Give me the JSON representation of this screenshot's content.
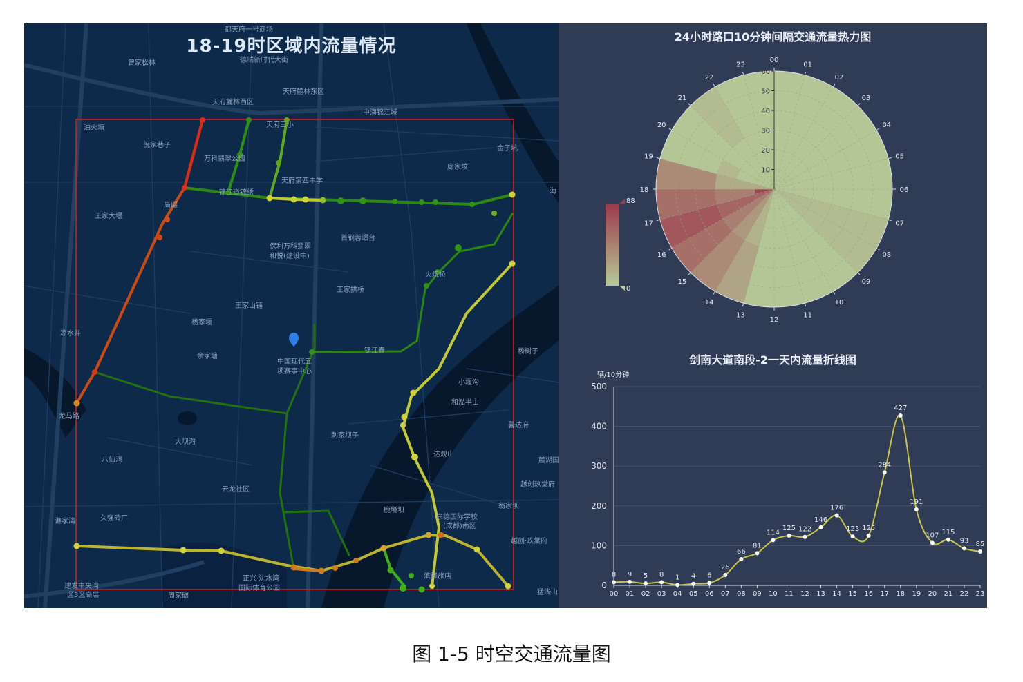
{
  "map": {
    "title": "18-19时区域内流量情况",
    "places": [
      {
        "id": "p1",
        "text": "都天府一号商场"
      },
      {
        "id": "p2",
        "text": "曾家松林"
      },
      {
        "id": "p3",
        "text": "德瑞新时代大街"
      },
      {
        "id": "p4",
        "text": "天府麓林东区"
      },
      {
        "id": "p5",
        "text": "天府麓林西区"
      },
      {
        "id": "p6",
        "text": "中海锦江城"
      },
      {
        "id": "p7",
        "text": "天府三小"
      },
      {
        "id": "p8",
        "text": "油火塘"
      },
      {
        "id": "p9",
        "text": "倪家巷子"
      },
      {
        "id": "p10",
        "text": "万科翡翠公园"
      },
      {
        "id": "p11",
        "text": "金子坑"
      },
      {
        "id": "p12",
        "text": "廊家坟"
      },
      {
        "id": "p13",
        "text": "锦江道锦绣"
      },
      {
        "id": "p14",
        "text": "天府第四中学"
      },
      {
        "id": "p15",
        "text": "高碾"
      },
      {
        "id": "p16",
        "text": "王家大堰"
      },
      {
        "id": "p17",
        "text": "首钢蓉璟台"
      },
      {
        "id": "p18",
        "text": "保利万科翡翠"
      },
      {
        "id": "p19",
        "text": "和悦(建设中)"
      },
      {
        "id": "p20",
        "text": "火烧桥"
      },
      {
        "id": "p21",
        "text": "王家拱桥"
      },
      {
        "id": "p22",
        "text": "王家山铺"
      },
      {
        "id": "p23",
        "text": "杨家堰"
      },
      {
        "id": "p24",
        "text": "凉水井"
      },
      {
        "id": "p25",
        "text": "余家塘"
      },
      {
        "id": "p26",
        "text": "中国现代五"
      },
      {
        "id": "p27",
        "text": "项赛事中心"
      },
      {
        "id": "p28",
        "text": "锦江春"
      },
      {
        "id": "p29",
        "text": "杨树子"
      },
      {
        "id": "p30",
        "text": "小堰沟"
      },
      {
        "id": "p31",
        "text": "和泓半山"
      },
      {
        "id": "p32",
        "text": "龙马路"
      },
      {
        "id": "p33",
        "text": "刺家坝子"
      },
      {
        "id": "p34",
        "text": "大坝沟"
      },
      {
        "id": "p35",
        "text": "馨达府"
      },
      {
        "id": "p36",
        "text": "达观山"
      },
      {
        "id": "p37",
        "text": "八仙洞"
      },
      {
        "id": "p38",
        "text": "麓湖国"
      },
      {
        "id": "p39",
        "text": "越创玖棠府"
      },
      {
        "id": "p40",
        "text": "云龙社区"
      },
      {
        "id": "p41",
        "text": "康德国际学校"
      },
      {
        "id": "p42",
        "text": "(成都)南区"
      },
      {
        "id": "p43",
        "text": "谯家湾"
      },
      {
        "id": "p44",
        "text": "久强砖厂"
      },
      {
        "id": "p45",
        "text": "鹿境坝"
      },
      {
        "id": "p46",
        "text": "翁家坝"
      },
      {
        "id": "p47",
        "text": "越创·玖棠府"
      },
      {
        "id": "p48",
        "text": "正兴·沈水湾"
      },
      {
        "id": "p49",
        "text": "国际体育公园"
      },
      {
        "id": "p50",
        "text": "建发中央湾"
      },
      {
        "id": "p51",
        "text": "区3区高层"
      },
      {
        "id": "p52",
        "text": "周家碾"
      },
      {
        "id": "p53",
        "text": "滨驿旅店"
      },
      {
        "id": "p54",
        "text": "猛浅山"
      },
      {
        "id": "p55",
        "text": "海"
      }
    ]
  },
  "heatmap": {
    "title": "24小时路口10分钟间隔交通流量热力图",
    "angle_labels": [
      "00",
      "01",
      "02",
      "03",
      "04",
      "05",
      "06",
      "07",
      "08",
      "09",
      "10",
      "11",
      "12",
      "13",
      "14",
      "15",
      "16",
      "17",
      "18",
      "19",
      "20",
      "21",
      "22",
      "23"
    ],
    "radius_labels": [
      "10",
      "20",
      "30",
      "40",
      "50",
      "60"
    ],
    "visualmap": {
      "max": "88",
      "min": "0",
      "low_color": "#b6c997",
      "high_color": "#9c3a4c"
    }
  },
  "chart_data": {
    "type": "line",
    "title": "剑南大道南段-2一天内流量折线图",
    "ylabel": "辆/10分钟",
    "xlabel": "",
    "categories": [
      "00",
      "01",
      "02",
      "03",
      "04",
      "05",
      "06",
      "07",
      "08",
      "09",
      "10",
      "11",
      "12",
      "13",
      "14",
      "15",
      "16",
      "17",
      "18",
      "19",
      "20",
      "21",
      "22",
      "23"
    ],
    "values": [
      8,
      9,
      5,
      8,
      1,
      4,
      6,
      26,
      66,
      81,
      114,
      125,
      122,
      146,
      176,
      123,
      125,
      284,
      427,
      191,
      107,
      115,
      93,
      85
    ],
    "ylim": [
      0,
      500
    ],
    "yticks": [
      "0",
      "100",
      "200",
      "300",
      "400",
      "500"
    ],
    "line_color": "#c9c54a",
    "grid": true
  },
  "caption": "图 1-5  时空交通流量图",
  "colors": {
    "map_bg": "#0d2a4a",
    "panel_bg": "#303b55",
    "box": "#d21f1f"
  }
}
